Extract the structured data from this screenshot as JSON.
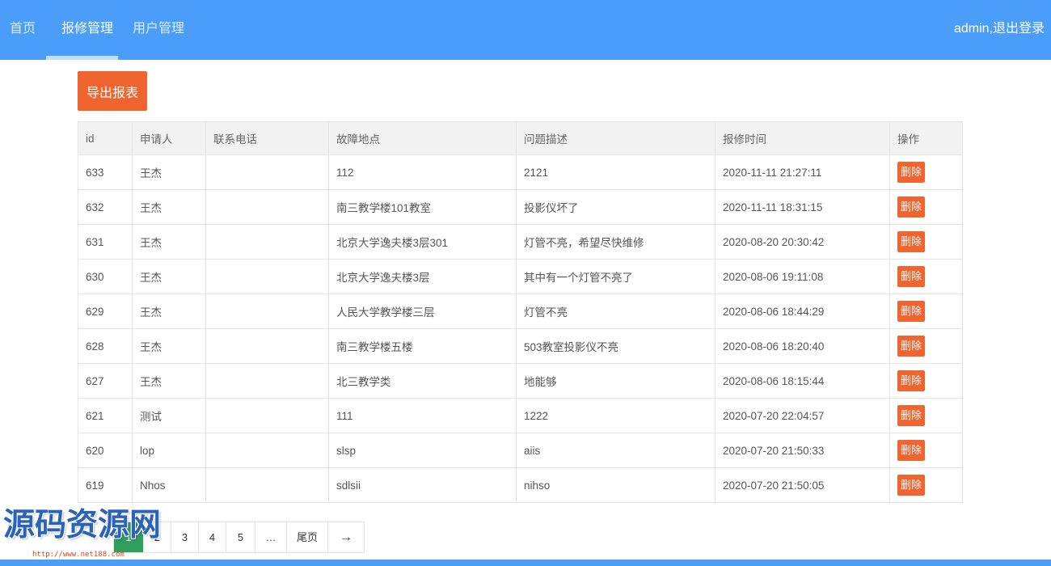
{
  "nav": {
    "items": [
      {
        "label": "首页"
      },
      {
        "label": "报修管理"
      },
      {
        "label": "用户管理"
      }
    ],
    "active_index": 1,
    "user_text": "admin,退出登录"
  },
  "toolbar": {
    "export_label": "导出报表"
  },
  "table": {
    "columns": [
      "id",
      "申请人",
      "联系电话",
      "故障地点",
      "问题描述",
      "报修时间",
      "操作"
    ],
    "rows": [
      {
        "id": "633",
        "applicant": "王杰",
        "phone": "",
        "location": "112",
        "description": "2121",
        "time": "2020-11-11 21:27:11",
        "action": "删除"
      },
      {
        "id": "632",
        "applicant": "王杰",
        "phone": "",
        "location": "南三教学楼101教室",
        "description": "投影仪坏了",
        "time": "2020-11-11 18:31:15",
        "action": "删除"
      },
      {
        "id": "631",
        "applicant": "王杰",
        "phone": "",
        "location": "北京大学逸夫楼3层301",
        "description": "灯管不亮，希望尽快维修",
        "time": "2020-08-20 20:30:42",
        "action": "删除"
      },
      {
        "id": "630",
        "applicant": "王杰",
        "phone": "",
        "location": "北京大学逸夫楼3层",
        "description": "其中有一个灯管不亮了",
        "time": "2020-08-06 19:11:08",
        "action": "删除"
      },
      {
        "id": "629",
        "applicant": "王杰",
        "phone": "",
        "location": "人民大学教学楼三层",
        "description": "灯管不亮",
        "time": "2020-08-06 18:44:29",
        "action": "删除"
      },
      {
        "id": "628",
        "applicant": "王杰",
        "phone": "",
        "location": "南三教学楼五楼",
        "description": "503教室投影仪不亮",
        "time": "2020-08-06 18:20:40",
        "action": "删除"
      },
      {
        "id": "627",
        "applicant": "王杰",
        "phone": "",
        "location": "北三教学类",
        "description": "地能够",
        "time": "2020-08-06 18:15:44",
        "action": "删除"
      },
      {
        "id": "621",
        "applicant": "测试",
        "phone": "",
        "location": "111",
        "description": "1222",
        "time": "2020-07-20 22:04:57",
        "action": "删除"
      },
      {
        "id": "620",
        "applicant": "lop",
        "phone": "",
        "location": "slsp",
        "description": "aiis",
        "time": "2020-07-20 21:50:33",
        "action": "删除"
      },
      {
        "id": "619",
        "applicant": "Nhos",
        "phone": "",
        "location": "sdlsii",
        "description": "nihso",
        "time": "2020-07-20 21:50:05",
        "action": "删除"
      }
    ]
  },
  "pagination": {
    "items": [
      "1",
      "2",
      "3",
      "4",
      "5",
      "…",
      "尾页",
      "→"
    ],
    "current_index": 0
  },
  "watermark": {
    "text": "源码资源网",
    "url": "http://www.net188.com"
  },
  "colors": {
    "header_bg": "#4a9df8",
    "accent_orange": "#f0642f",
    "page_current": "#2f9e5f"
  }
}
